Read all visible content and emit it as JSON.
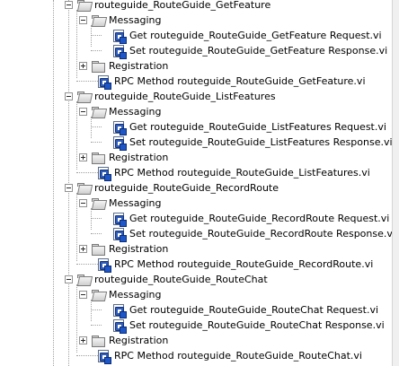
{
  "tree": {
    "groups": [
      {
        "label": "routeguide_RouteGuide_GetFeature",
        "messaging_label": "Messaging",
        "request_label": "Get routeguide_RouteGuide_GetFeature Request.vi",
        "response_label": "Set routeguide_RouteGuide_GetFeature Response.vi",
        "registration_label": "Registration",
        "method_label": "RPC Method routeguide_RouteGuide_GetFeature.vi"
      },
      {
        "label": "routeguide_RouteGuide_ListFeatures",
        "messaging_label": "Messaging",
        "request_label": "Get routeguide_RouteGuide_ListFeatures Request.vi",
        "response_label": "Set routeguide_RouteGuide_ListFeatures Response.vi",
        "registration_label": "Registration",
        "method_label": "RPC Method routeguide_RouteGuide_ListFeatures.vi"
      },
      {
        "label": "routeguide_RouteGuide_RecordRoute",
        "messaging_label": "Messaging",
        "request_label": "Get routeguide_RouteGuide_RecordRoute Request.vi",
        "response_label": "Set routeguide_RouteGuide_RecordRoute Response.vi",
        "registration_label": "Registration",
        "method_label": "RPC Method routeguide_RouteGuide_RecordRoute.vi"
      },
      {
        "label": "routeguide_RouteGuide_RouteChat",
        "messaging_label": "Messaging",
        "request_label": "Get routeguide_RouteGuide_RouteChat Request.vi",
        "response_label": "Set routeguide_RouteGuide_RouteChat Response.vi",
        "registration_label": "Registration",
        "method_label": "RPC Method routeguide_RouteGuide_RouteChat.vi"
      }
    ]
  }
}
